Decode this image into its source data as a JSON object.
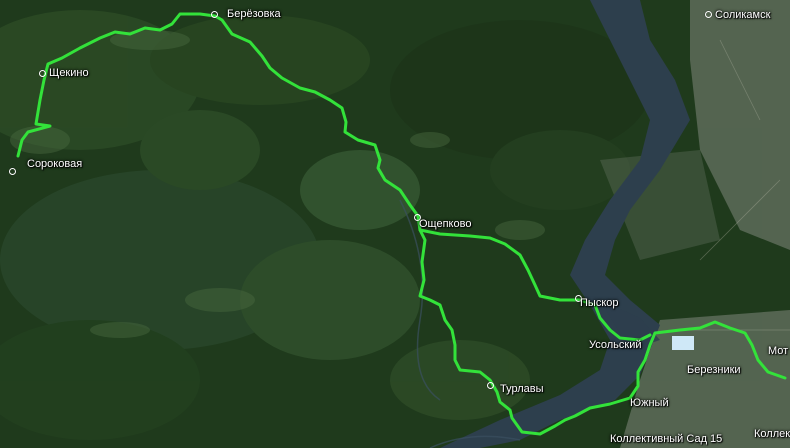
{
  "map": {
    "route_color": "#33e23a",
    "river_color": "#2d3f4d",
    "forest_color": "#1f3a1c",
    "city_color": "#8f968e"
  },
  "places": {
    "berezovka": "Берёзовка",
    "solikamsk": "Соликамск",
    "shchekino": "Щекино",
    "sorokovaya": "Сороковая",
    "oshchepkovo": "Ощепково",
    "pyskor": "Пыскор",
    "usolsky": "Усольский",
    "berezniki": "Березники",
    "mot": "Мот",
    "turlavy": "Турлавы",
    "yuzhny": "Южный",
    "kollektivny_sad_15": "Коллективный Сад 15",
    "kollektiv": "Коллектив"
  }
}
